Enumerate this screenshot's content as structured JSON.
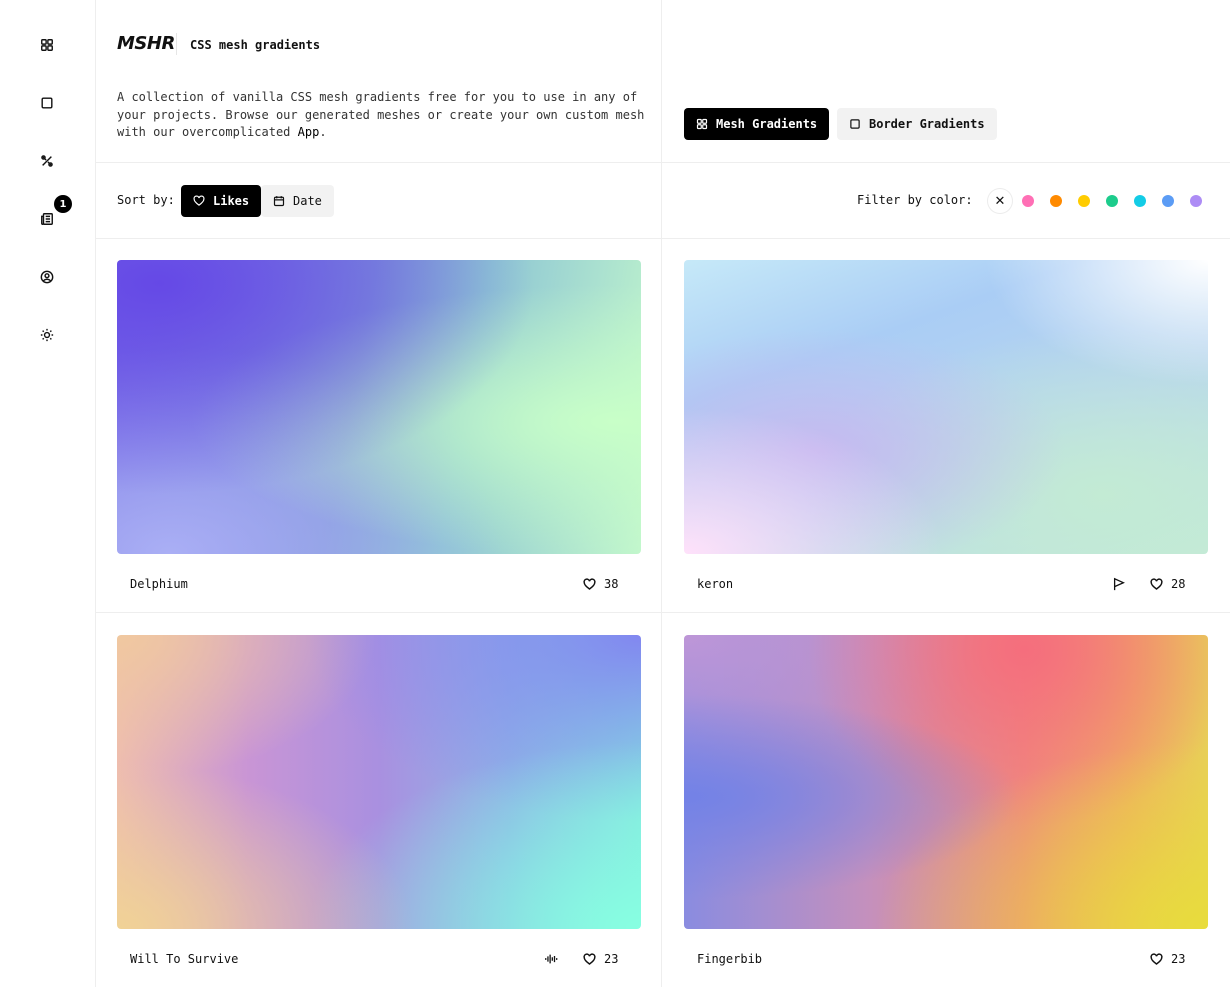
{
  "brand": {
    "logo_text": "MSHR",
    "site_title": "CSS mesh gradients"
  },
  "sidebar": {
    "items": [
      {
        "icon": "grid-icon"
      },
      {
        "icon": "square-icon"
      },
      {
        "icon": "tools-icon"
      },
      {
        "icon": "newspaper-icon",
        "badge": "1"
      },
      {
        "icon": "user-circle-icon"
      },
      {
        "icon": "sun-icon"
      }
    ]
  },
  "header": {
    "description_prefix": "A collection of vanilla CSS mesh gradients free for you to use in any of your projects. Browse our generated meshes or create your own custom mesh with our overcomplicated ",
    "description_link": "App",
    "description_suffix": ".",
    "tabs": [
      {
        "label": "Mesh Gradients",
        "active": true
      },
      {
        "label": "Border Gradients",
        "active": false
      }
    ]
  },
  "toolbar": {
    "sort_label": "Sort by:",
    "sort_options": [
      {
        "label": "Likes",
        "active": true
      },
      {
        "label": "Date",
        "active": false
      }
    ],
    "filter_label": "Filter by color:",
    "clear_symbol": "✕",
    "colors": [
      "#ff6fb5",
      "#ff8a00",
      "#ffcc00",
      "#1ccc8c",
      "#13cce6",
      "#5b9cf5",
      "#ad8cf5"
    ]
  },
  "gradients": [
    {
      "name": "Delphium",
      "likes": "38"
    },
    {
      "name": "keron",
      "likes": "28",
      "extra_icon": "flag-icon"
    },
    {
      "name": "Will To Survive",
      "likes": "23",
      "extra_icon": "audio-wave-icon"
    },
    {
      "name": "Fingerbib",
      "likes": "23"
    }
  ]
}
